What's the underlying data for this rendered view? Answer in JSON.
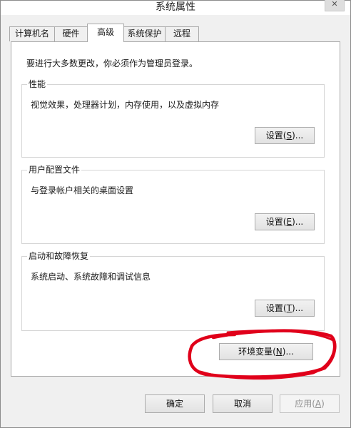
{
  "window": {
    "title": "系统属性",
    "close_label": "✕"
  },
  "tabs": [
    {
      "label": "计算机名",
      "active": false
    },
    {
      "label": "硬件",
      "active": false
    },
    {
      "label": "高级",
      "active": true
    },
    {
      "label": "系统保护",
      "active": false
    },
    {
      "label": "远程",
      "active": false
    }
  ],
  "panel": {
    "admin_note": "要进行大多数更改，你必须作为管理员登录。",
    "performance": {
      "title": "性能",
      "description": "视觉效果，处理器计划，内存使用，以及虚拟内存",
      "button": {
        "text": "设置(",
        "key": "S",
        "suffix": ")..."
      }
    },
    "user_profiles": {
      "title": "用户配置文件",
      "description": "与登录帐户相关的桌面设置",
      "button": {
        "text": "设置(",
        "key": "E",
        "suffix": ")..."
      }
    },
    "startup_recovery": {
      "title": "启动和故障恢复",
      "description": "系统启动、系统故障和调试信息",
      "button": {
        "text": "设置(",
        "key": "T",
        "suffix": ")..."
      }
    },
    "env_button": {
      "text": "环境变量(",
      "key": "N",
      "suffix": ")..."
    }
  },
  "footer": {
    "ok": "确定",
    "cancel": "取消",
    "apply": {
      "text": "应用(",
      "key": "A",
      "suffix": ")"
    }
  },
  "colors": {
    "highlight_circle": "#e0001a",
    "window_bg": "#f0f0f0"
  }
}
